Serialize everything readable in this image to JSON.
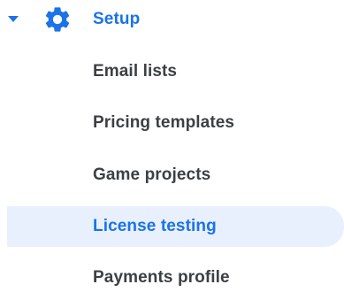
{
  "nav": {
    "group": {
      "label": "Setup",
      "expanded": true,
      "caret_icon": "caret-down-icon",
      "icon": "gear-icon"
    },
    "items": [
      {
        "label": "Email lists",
        "active": false
      },
      {
        "label": "Pricing templates",
        "active": false
      },
      {
        "label": "Game projects",
        "active": false
      },
      {
        "label": "License testing",
        "active": true
      },
      {
        "label": "Payments profile",
        "active": false
      }
    ]
  },
  "colors": {
    "accent": "#1a73e8",
    "active_background": "#e8f0fe",
    "text": "#3c4043"
  }
}
